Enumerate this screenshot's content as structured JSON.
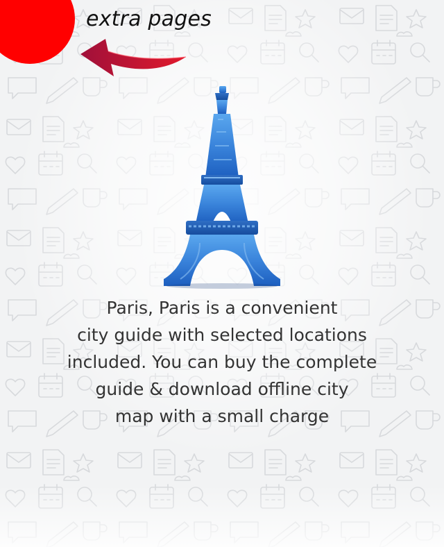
{
  "header": {
    "extra_pages_label": "extra pages"
  },
  "intro": {
    "description_lines": [
      "Paris, Paris is a convenient",
      "city guide with selected locations",
      "included. You can buy the complete",
      "guide & download offline city",
      "map with a small charge"
    ]
  },
  "icons": {
    "hint_arrow": "curved-arrow-icon",
    "hero": "eiffel-tower-icon",
    "background": "doodle-pattern"
  },
  "colors": {
    "accent_dot": "#ff0000",
    "arrow": "#c8102e",
    "tower": "#2a6fd1",
    "text": "#333333",
    "background": "#f2f3f4"
  }
}
